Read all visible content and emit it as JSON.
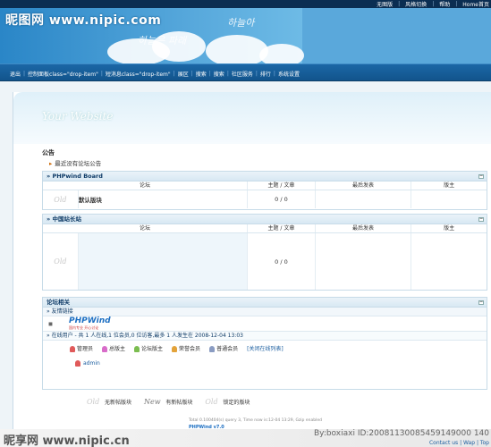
{
  "topbar": {
    "links": [
      "无图版",
      "风格切换",
      "帮助",
      "Home首页"
    ]
  },
  "banner": {
    "watermark": "昵图网 www.nipic.com",
    "handwriting_top": "하늘아",
    "handwriting_mid": "하늘은 파래"
  },
  "nav": {
    "items": [
      "退出",
      "控制面板class=\"drop-item\"",
      "短消息class=\"drop-item\"",
      "展区",
      "搜索",
      "搜索",
      "社区服务",
      "排行",
      "系统设置"
    ]
  },
  "header": {
    "logo": "Your Website"
  },
  "notice": {
    "title": "公告",
    "item": "最近没有论坛公告"
  },
  "board1": {
    "title": "» PHPwind Board",
    "cols": [
      "论坛",
      "主题 / 文章",
      "最后发表",
      "版主"
    ],
    "rows": [
      {
        "name": "默认版块",
        "count": "0 / 0"
      }
    ]
  },
  "board2": {
    "title": "» 中国站长站",
    "cols": [
      "论坛",
      "主题 / 文章",
      "最后发表",
      "版主"
    ],
    "rows": [
      {
        "count": "0 / 0"
      }
    ]
  },
  "info": {
    "title": "论坛相关",
    "links_title": "» 友情链接",
    "phpwind": "PHPWind",
    "phpwind_sub": "国内专业 开心讨论",
    "online": "» 在线用户 - 共 1 人在线,1 位会员,0 位访客,最多 1 人发生在 2008-12-04 13:03",
    "legend": [
      {
        "label": "管理员",
        "color": "#e05a5a"
      },
      {
        "label": "总版主",
        "color": "#d86cc9"
      },
      {
        "label": "论坛版主",
        "color": "#7bbd50"
      },
      {
        "label": "荣誉会员",
        "color": "#e3a33a"
      },
      {
        "label": "普通会员",
        "color": "#8a9cc2"
      }
    ],
    "legend_link": "[关闭在线列表]",
    "member": "admin"
  },
  "footer": {
    "legend": [
      {
        "tag": "Old",
        "label": "无新帖版块"
      },
      {
        "tag": "New",
        "label": "有新帖版块"
      },
      {
        "tag": "Old",
        "label": "锁定的版块"
      }
    ],
    "debug": "Total 0.100404(s) query 3, Time now is:12-04 13:29, Gzip enabled",
    "pw": "PHPWind v7.0"
  },
  "watermark_bottom": {
    "left": "昵享网 www.nipic.cn",
    "right": "By:boxiaxi ID:20081130085459149000 140",
    "contact": "Contact us | Wap | Top"
  }
}
